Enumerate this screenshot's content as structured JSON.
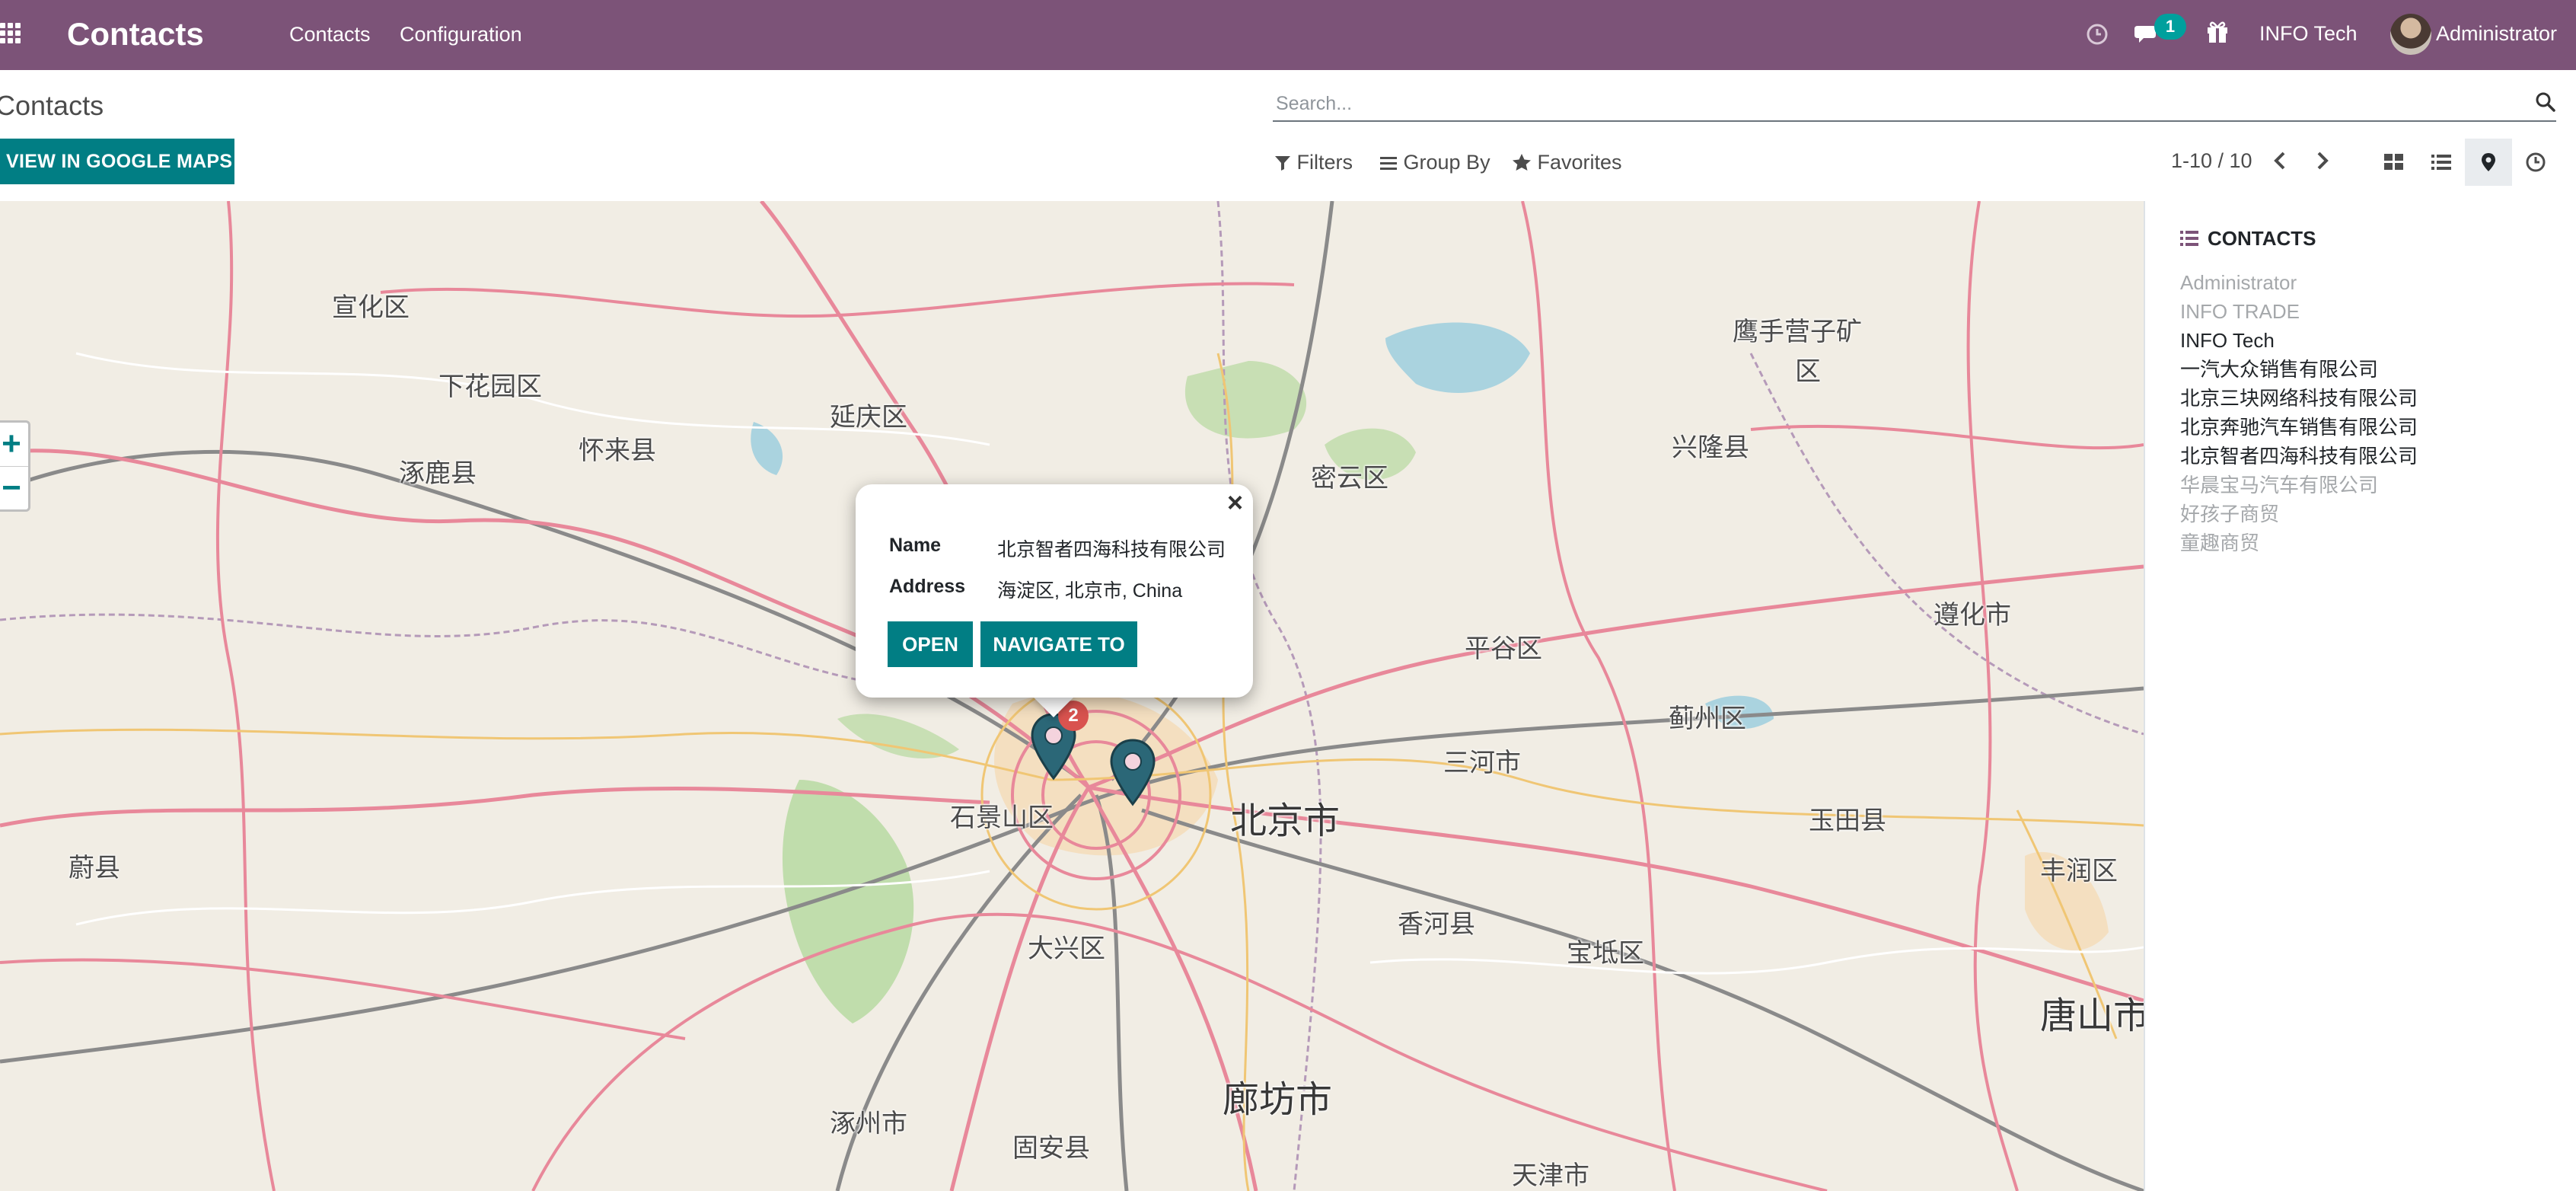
{
  "navbar": {
    "app_name": "Contacts",
    "menu": [
      "Contacts",
      "Configuration"
    ],
    "messages_count": "1",
    "company": "INFO Tech",
    "user": "Administrator",
    "bg_color": "#7c5378"
  },
  "control_panel": {
    "breadcrumb": "Contacts",
    "search_placeholder": "Search...",
    "google_maps_button": "VIEW IN GOOGLE MAPS",
    "filters_label": "Filters",
    "groupby_label": "Group By",
    "favorites_label": "Favorites",
    "pager": "1-10 / 10",
    "views": [
      "kanban-view",
      "list-view",
      "map-view",
      "activity-view"
    ],
    "active_view": "map-view",
    "accent_color": "#017e84"
  },
  "map": {
    "zoom_in": "+",
    "zoom_out": "−",
    "labels": [
      "宣化区",
      "下花园区",
      "延庆区",
      "涿鹿县",
      "怀来县",
      "密云区",
      "鹰手营子矿",
      "区",
      "兴隆县",
      "平谷区",
      "遵化市",
      "蓟州区",
      "三河市",
      "北京市",
      "玉田县",
      "丰润区",
      "石景山区",
      "大兴区",
      "香河县",
      "宝坻区",
      "唐山市",
      "蔚县",
      "涿州市",
      "固安县",
      "廊坊市",
      "天津市"
    ],
    "marker_cluster_count": "2"
  },
  "popup": {
    "name_label": "Name",
    "name_value": "北京智者四海科技有限公司",
    "address_label": "Address",
    "address_value": "海淀区, 北京市, China",
    "open_button": "OPEN",
    "navigate_button": "NAVIGATE TO",
    "close": "×"
  },
  "sidebar": {
    "title": "CONTACTS",
    "contacts": [
      {
        "name": "Administrator",
        "style": "muted"
      },
      {
        "name": "INFO TRADE",
        "style": "muted"
      },
      {
        "name": "INFO Tech",
        "style": "dark"
      },
      {
        "name": "一汽大众销售有限公司",
        "style": "dark"
      },
      {
        "name": "北京三块网络科技有限公司",
        "style": "dark"
      },
      {
        "name": "北京奔驰汽车销售有限公司",
        "style": "dark"
      },
      {
        "name": "北京智者四海科技有限公司",
        "style": "dark"
      },
      {
        "name": "华晨宝马汽车有限公司",
        "style": "muted"
      },
      {
        "name": "好孩子商贸",
        "style": "muted"
      },
      {
        "name": "童趣商贸",
        "style": "muted"
      }
    ]
  }
}
